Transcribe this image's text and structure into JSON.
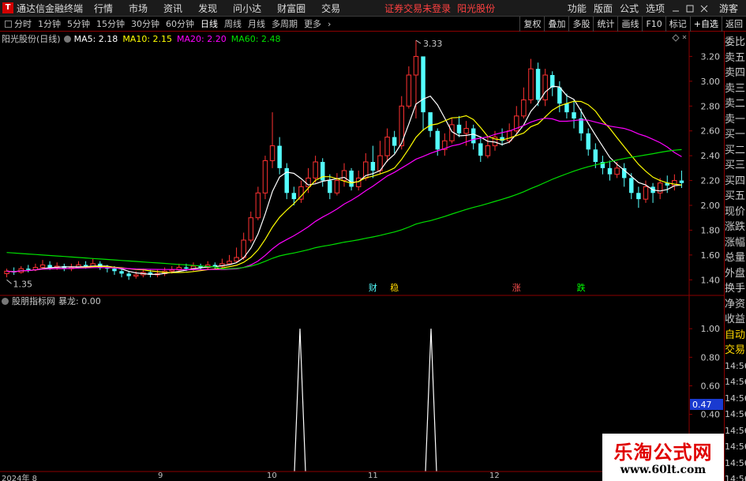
{
  "app": {
    "title": "通达信金融终端",
    "alert": "证券交易未登录",
    "stock": "阳光股份"
  },
  "menu": [
    "行情",
    "市场",
    "资讯",
    "发现",
    "问小达",
    "财富圈",
    "交易"
  ],
  "menu_right": [
    "功能",
    "版面",
    "公式",
    "选项"
  ],
  "guest": "游客",
  "periods": [
    "分时",
    "1分钟",
    "5分钟",
    "15分钟",
    "30分钟",
    "60分钟",
    "日线",
    "周线",
    "月线",
    "多周期",
    "更多"
  ],
  "active_period": "日线",
  "tools": [
    "复权",
    "叠加",
    "多股",
    "统计",
    "画线",
    "F10",
    "标记",
    "+自选",
    "返回"
  ],
  "main_legend": {
    "name": "阳光股份(日线)",
    "ma5": "MA5: 2.18",
    "ma10": "MA10: 2.15",
    "ma20": "MA20: 2.20",
    "ma60": "MA60: 2.48"
  },
  "colors": {
    "up": "#ff3232",
    "down": "#54ffff",
    "ma5": "#ffffff",
    "ma10": "#ffff00",
    "ma20": "#ff00ff",
    "ma60": "#00e000",
    "axis": "#8b0000"
  },
  "annotations": {
    "high": "3.33",
    "low": "1.35"
  },
  "signals": [
    {
      "label": "财",
      "color": "#54ffff"
    },
    {
      "label": "稳",
      "color": "#ffd700"
    },
    {
      "label": "涨",
      "color": "#ff5050"
    },
    {
      "label": "跌",
      "color": "#00ff00"
    }
  ],
  "indicator_legend": {
    "name": "股朋指标网",
    "value": "暴龙: 0.00"
  },
  "indicator_current": "0.47",
  "side_labels": [
    "委比",
    "卖五",
    "卖四",
    "卖三",
    "卖二",
    "卖一",
    "买一",
    "买二",
    "买三",
    "买四",
    "买五",
    "现价",
    "涨跌",
    "涨幅",
    "总量",
    "外盘",
    "换手",
    "净资",
    "收益"
  ],
  "side_auto": "自动",
  "side_trade": "交易",
  "side_times": [
    "14:56",
    "14:56",
    "14:56",
    "14:56",
    "14:56",
    "14:56",
    "14:56",
    "14:56"
  ],
  "x_axis_labels": [
    "2024年 8",
    "9",
    "10",
    "11",
    "12"
  ],
  "watermark": {
    "title": "乐淘公式网",
    "url": "www.60lt.com"
  },
  "chart_data": [
    {
      "type": "candlestick",
      "price_axis": [
        3.2,
        3.0,
        2.8,
        2.6,
        2.4,
        2.2,
        2.0,
        1.8,
        1.6,
        1.4
      ],
      "ylim": [
        1.3,
        3.4
      ],
      "candles": [
        [
          1.45,
          1.47,
          1.49,
          1.42
        ],
        [
          1.47,
          1.46,
          1.5,
          1.44
        ],
        [
          1.46,
          1.49,
          1.51,
          1.45
        ],
        [
          1.49,
          1.48,
          1.52,
          1.46
        ],
        [
          1.48,
          1.5,
          1.53,
          1.47
        ],
        [
          1.5,
          1.52,
          1.56,
          1.49
        ],
        [
          1.52,
          1.5,
          1.55,
          1.48
        ],
        [
          1.5,
          1.51,
          1.54,
          1.48
        ],
        [
          1.51,
          1.49,
          1.53,
          1.47
        ],
        [
          1.49,
          1.5,
          1.53,
          1.47
        ],
        [
          1.5,
          1.52,
          1.55,
          1.49
        ],
        [
          1.52,
          1.51,
          1.55,
          1.49
        ],
        [
          1.51,
          1.53,
          1.57,
          1.5
        ],
        [
          1.53,
          1.5,
          1.55,
          1.48
        ],
        [
          1.5,
          1.49,
          1.52,
          1.46
        ],
        [
          1.49,
          1.47,
          1.51,
          1.44
        ],
        [
          1.47,
          1.45,
          1.49,
          1.42
        ],
        [
          1.45,
          1.43,
          1.47,
          1.4
        ],
        [
          1.43,
          1.44,
          1.47,
          1.41
        ],
        [
          1.44,
          1.46,
          1.49,
          1.42
        ],
        [
          1.46,
          1.44,
          1.48,
          1.42
        ],
        [
          1.44,
          1.45,
          1.48,
          1.42
        ],
        [
          1.45,
          1.47,
          1.5,
          1.43
        ],
        [
          1.47,
          1.48,
          1.51,
          1.45
        ],
        [
          1.48,
          1.5,
          1.53,
          1.46
        ],
        [
          1.5,
          1.49,
          1.53,
          1.47
        ],
        [
          1.49,
          1.51,
          1.54,
          1.47
        ],
        [
          1.51,
          1.5,
          1.53,
          1.48
        ],
        [
          1.5,
          1.52,
          1.55,
          1.48
        ],
        [
          1.52,
          1.51,
          1.54,
          1.49
        ],
        [
          1.51,
          1.53,
          1.57,
          1.5
        ],
        [
          1.53,
          1.55,
          1.6,
          1.52
        ],
        [
          1.55,
          1.58,
          1.66,
          1.54
        ],
        [
          1.58,
          1.72,
          1.78,
          1.56
        ],
        [
          1.72,
          1.9,
          1.95,
          1.7
        ],
        [
          1.9,
          2.1,
          2.15,
          1.88
        ],
        [
          2.1,
          2.36,
          2.4,
          2.05
        ],
        [
          2.36,
          2.48,
          2.75,
          2.3
        ],
        [
          2.48,
          2.3,
          2.55,
          2.25
        ],
        [
          2.3,
          2.1,
          2.34,
          2.05
        ],
        [
          2.1,
          2.05,
          2.15,
          2.0
        ],
        [
          2.05,
          2.15,
          2.2,
          2.02
        ],
        [
          2.15,
          2.22,
          2.3,
          2.1
        ],
        [
          2.22,
          2.35,
          2.4,
          2.18
        ],
        [
          2.35,
          2.2,
          2.38,
          2.15
        ],
        [
          2.2,
          2.1,
          2.25,
          2.05
        ],
        [
          2.1,
          2.2,
          2.26,
          2.08
        ],
        [
          2.2,
          2.28,
          2.34,
          2.15
        ],
        [
          2.28,
          2.15,
          2.3,
          2.12
        ],
        [
          2.15,
          2.22,
          2.28,
          2.12
        ],
        [
          2.22,
          2.35,
          2.42,
          2.2
        ],
        [
          2.35,
          2.28,
          2.48,
          2.22
        ],
        [
          2.28,
          2.4,
          2.52,
          2.25
        ],
        [
          2.4,
          2.55,
          2.62,
          2.35
        ],
        [
          2.55,
          2.48,
          2.6,
          2.42
        ],
        [
          2.48,
          2.8,
          2.88,
          2.45
        ],
        [
          2.8,
          3.05,
          3.12,
          2.78
        ],
        [
          3.05,
          3.2,
          3.33,
          2.7
        ],
        [
          3.2,
          2.75,
          3.0,
          2.6
        ],
        [
          2.75,
          2.6,
          2.7,
          2.55
        ],
        [
          2.6,
          2.45,
          2.62,
          2.4
        ],
        [
          2.45,
          2.52,
          2.58,
          2.4
        ],
        [
          2.52,
          2.65,
          2.7,
          2.5
        ],
        [
          2.65,
          2.58,
          2.72,
          2.55
        ],
        [
          2.58,
          2.62,
          2.68,
          2.48
        ],
        [
          2.62,
          2.5,
          2.65,
          2.45
        ],
        [
          2.5,
          2.4,
          2.54,
          2.35
        ],
        [
          2.4,
          2.48,
          2.55,
          2.38
        ],
        [
          2.48,
          2.55,
          2.6,
          2.44
        ],
        [
          2.55,
          2.52,
          2.62,
          2.48
        ],
        [
          2.52,
          2.6,
          2.66,
          2.5
        ],
        [
          2.6,
          2.72,
          2.8,
          2.58
        ],
        [
          2.72,
          2.85,
          2.95,
          2.7
        ],
        [
          2.85,
          3.1,
          3.18,
          2.82
        ],
        [
          3.1,
          2.85,
          3.15,
          2.8
        ],
        [
          2.85,
          3.05,
          3.1,
          2.8
        ],
        [
          3.05,
          2.95,
          3.08,
          2.88
        ],
        [
          2.95,
          2.82,
          3.0,
          2.75
        ],
        [
          2.82,
          2.75,
          2.9,
          2.7
        ],
        [
          2.75,
          2.7,
          2.85,
          2.62
        ],
        [
          2.7,
          2.58,
          2.78,
          2.52
        ],
        [
          2.58,
          2.45,
          2.62,
          2.4
        ],
        [
          2.45,
          2.35,
          2.5,
          2.3
        ],
        [
          2.35,
          2.3,
          2.4,
          2.25
        ],
        [
          2.3,
          2.25,
          2.36,
          2.2
        ],
        [
          2.25,
          2.3,
          2.35,
          2.22
        ],
        [
          2.3,
          2.22,
          2.34,
          2.15
        ],
        [
          2.22,
          2.1,
          2.26,
          2.05
        ],
        [
          2.1,
          2.05,
          2.15,
          1.98
        ],
        [
          2.05,
          2.15,
          2.2,
          2.02
        ],
        [
          2.15,
          2.1,
          2.18,
          2.02
        ],
        [
          2.1,
          2.18,
          2.22,
          2.05
        ],
        [
          2.18,
          2.16,
          2.24,
          2.1
        ],
        [
          2.16,
          2.2,
          2.25,
          2.12
        ],
        [
          2.2,
          2.18,
          2.28,
          2.14
        ]
      ]
    },
    {
      "type": "line",
      "series": [
        {
          "name": "暴龙",
          "values": [
            0,
            0,
            0,
            0,
            0,
            0,
            0,
            0,
            0,
            0,
            0,
            0,
            0,
            0,
            0,
            0,
            0,
            0,
            0,
            0,
            0,
            0,
            0,
            0,
            0,
            0,
            0,
            0,
            0,
            0,
            0,
            0,
            0,
            0,
            0,
            0,
            0,
            0,
            0,
            0,
            0,
            0,
            0,
            0,
            0,
            0,
            0,
            0,
            0,
            0,
            0,
            0,
            0,
            1,
            0,
            0,
            0,
            0,
            0,
            0,
            0,
            0,
            0,
            0,
            0,
            0,
            0,
            0,
            0,
            0,
            0,
            0,
            0,
            0,
            0,
            0,
            0,
            0,
            0,
            0,
            0,
            0,
            0,
            0,
            0,
            0,
            0,
            0,
            0,
            0,
            0,
            0,
            0,
            0,
            0,
            0,
            0,
            0,
            0,
            0
          ]
        }
      ],
      "price_axis": [
        1.0,
        0.8,
        0.6,
        0.4,
        0.2
      ],
      "ylim": [
        0,
        1.2
      ]
    }
  ]
}
